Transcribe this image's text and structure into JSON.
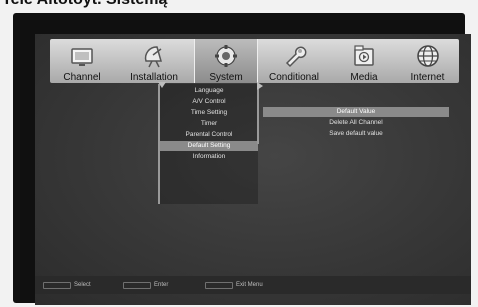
{
  "heading": "Tele Altotoyt. Sistemą",
  "menu_tabs": [
    {
      "label": "Channel",
      "icon": "tv-icon",
      "active": false
    },
    {
      "label": "Installation",
      "icon": "satellite-dish-icon",
      "active": false
    },
    {
      "label": "System",
      "icon": "gear-icon",
      "active": true
    },
    {
      "label": "Conditional",
      "icon": "wrench-icon",
      "active": false
    },
    {
      "label": "Media",
      "icon": "media-icon",
      "active": false
    },
    {
      "label": "Internet",
      "icon": "globe-icon",
      "active": false
    }
  ],
  "system_menu": {
    "items": [
      {
        "label": "Language"
      },
      {
        "label": "A/V Control"
      },
      {
        "label": "Time Setting"
      },
      {
        "label": "Timer"
      },
      {
        "label": "Parental Control"
      },
      {
        "label": "Default Setting",
        "selected": true
      },
      {
        "label": "Information"
      }
    ]
  },
  "default_setting_panel": {
    "items": [
      {
        "label": "Default Value",
        "selected": true
      },
      {
        "label": "Delete All Channel"
      },
      {
        "label": "Save default value"
      }
    ]
  },
  "hints": [
    {
      "label": "Select"
    },
    {
      "label": "Enter"
    },
    {
      "label": "Exit Menu"
    }
  ],
  "colors": {
    "menubar": "#c4c4c4",
    "screen_bg": "#3a3a3a",
    "selection": "#8a8a8a"
  }
}
